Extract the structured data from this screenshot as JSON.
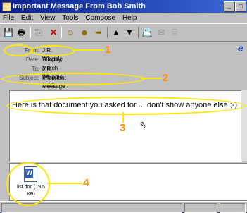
{
  "window": {
    "title": "Important Message From Bob Smith"
  },
  "menu": [
    "File",
    "Edit",
    "View",
    "Tools",
    "Compose",
    "Help"
  ],
  "toolbar": {
    "icons": [
      "save-icon",
      "print-icon",
      "copy-icon",
      "delete-icon",
      "reply-icon",
      "reply-all-icon",
      "forward-icon",
      "previous-icon",
      "next-icon",
      "address-book-icon",
      "send-receive-icon",
      "attach-icon"
    ]
  },
  "header": {
    "from_label": "From:",
    "from": "J.R. Whipple",
    "date_label": "Date:",
    "date": "Sunday, March 28, 1999 5:00 PM",
    "to_label": "To:",
    "to": "J.R. Whipple",
    "subject_label": "Subject:",
    "subject": "Important Message From Bob Smith"
  },
  "body": {
    "text": "Here is that document you asked for ... don't show anyone else ;-)"
  },
  "attachment": {
    "name": "list.doc (19.5 KB)"
  },
  "callouts": [
    "1",
    "2",
    "3",
    "4"
  ],
  "colors": {
    "highlight": "#ffe800",
    "callout_number": "#ff8c00",
    "titlebar": "#0a1f8f"
  }
}
